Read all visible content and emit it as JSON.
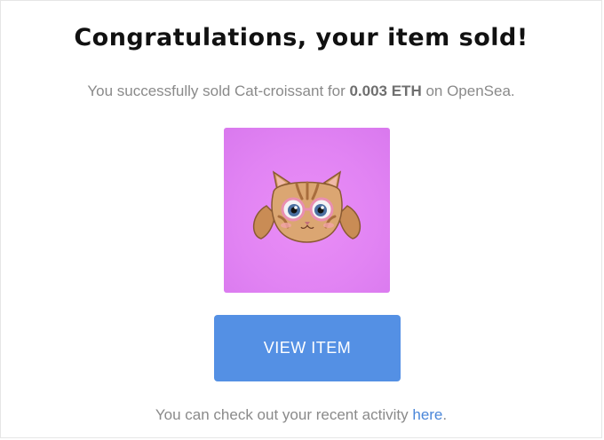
{
  "dialog": {
    "title": "Congratulations, your item sold!",
    "message": {
      "prefix": "You successfully sold Cat-croissant for ",
      "amount": "0.003 ETH",
      "suffix": " on OpenSea."
    },
    "item_image_icon": "cat-croissant-nft-image",
    "view_button_label": "VIEW ITEM",
    "footer": {
      "text": "You can check out your recent activity ",
      "link": "here",
      "end": "."
    }
  },
  "colors": {
    "button": "#5490e4",
    "link": "#4a86d9",
    "image_background": "#e183f3"
  }
}
